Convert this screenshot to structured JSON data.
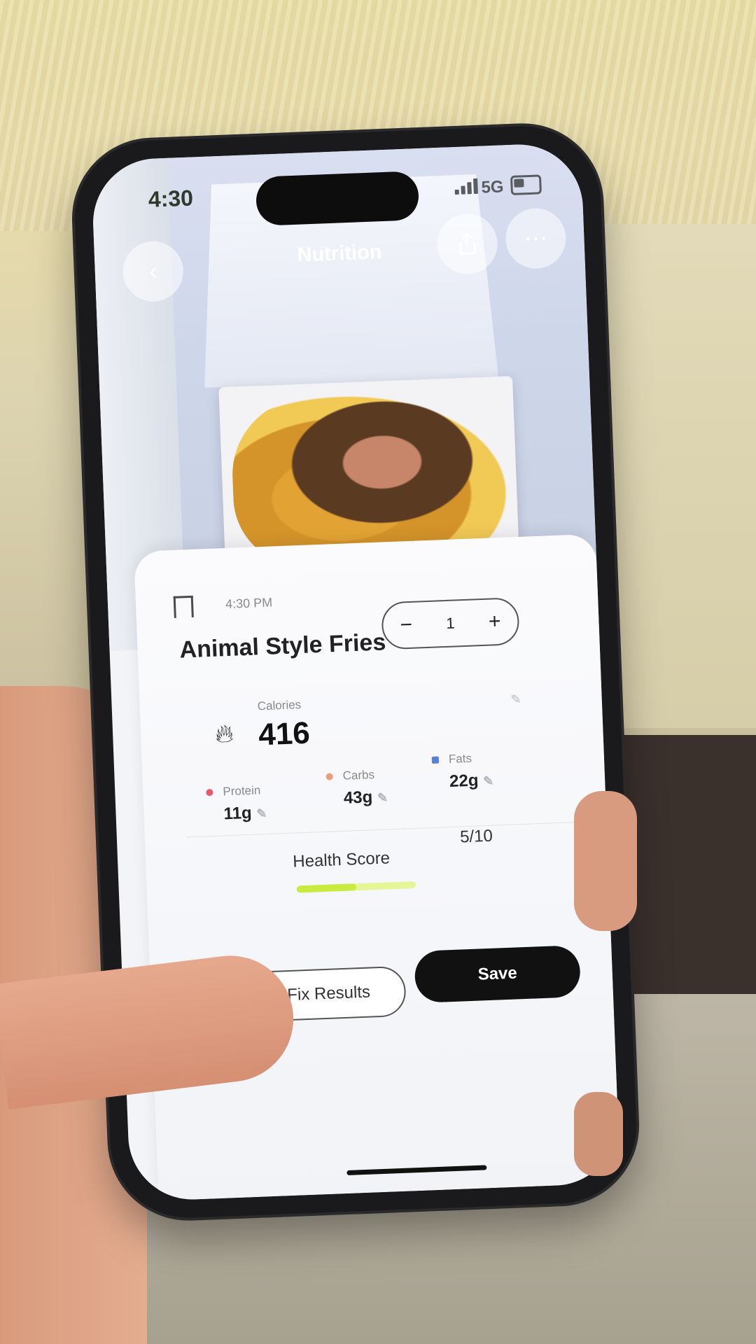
{
  "status_bar": {
    "time": "4:30",
    "network": "5G"
  },
  "header": {
    "title": "Nutrition"
  },
  "entry": {
    "timestamp": "4:30 PM",
    "food_name": "Animal Style Fries",
    "servings": "1",
    "minus": "−",
    "plus": "+"
  },
  "calories": {
    "label": "Calories",
    "value": "416"
  },
  "macros": [
    {
      "label": "Protein",
      "value": "11g",
      "color": "#e85a6a"
    },
    {
      "label": "Carbs",
      "value": "43g",
      "color": "#e8a07a"
    },
    {
      "label": "Fats",
      "value": "22g",
      "color": "#5b7de0"
    }
  ],
  "health_score": {
    "label": "Health Score",
    "value": "5/10",
    "fraction": 0.5
  },
  "actions": {
    "fix_label": "Fix Results",
    "save_label": "Save"
  },
  "icons": [
    "back-icon",
    "share-icon",
    "more-icon",
    "bookmark-icon",
    "flame-icon",
    "pencil-icon",
    "sparkle-icon"
  ]
}
